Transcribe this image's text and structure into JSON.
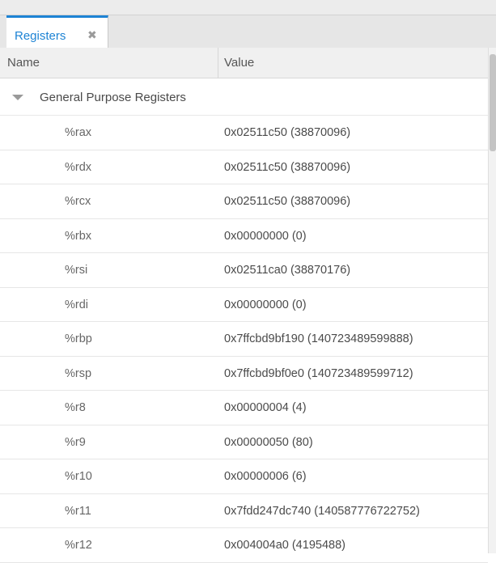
{
  "tab": {
    "label": "Registers",
    "close_glyph": "✖"
  },
  "table": {
    "columns": {
      "name": "Name",
      "value": "Value"
    },
    "group": {
      "label": "General Purpose Registers",
      "expanded": true
    },
    "registers": [
      {
        "name": "%rax",
        "value": "0x02511c50 (38870096)"
      },
      {
        "name": "%rdx",
        "value": "0x02511c50 (38870096)"
      },
      {
        "name": "%rcx",
        "value": "0x02511c50 (38870096)"
      },
      {
        "name": "%rbx",
        "value": "0x00000000 (0)"
      },
      {
        "name": "%rsi",
        "value": "0x02511ca0 (38870176)"
      },
      {
        "name": "%rdi",
        "value": "0x00000000 (0)"
      },
      {
        "name": "%rbp",
        "value": "0x7ffcbd9bf190 (140723489599888)"
      },
      {
        "name": "%rsp",
        "value": "0x7ffcbd9bf0e0 (140723489599712)"
      },
      {
        "name": "%r8",
        "value": "0x00000004 (4)"
      },
      {
        "name": "%r9",
        "value": "0x00000050 (80)"
      },
      {
        "name": "%r10",
        "value": "0x00000006 (6)"
      },
      {
        "name": "%r11",
        "value": "0x7fdd247dc740 (140587776722752)"
      },
      {
        "name": "%r12",
        "value": "0x004004a0 (4195488)"
      }
    ]
  },
  "colors": {
    "accent": "#1d83d4",
    "header_bg": "#f0f0f0",
    "tabbar_bg": "#e6e6e6"
  }
}
